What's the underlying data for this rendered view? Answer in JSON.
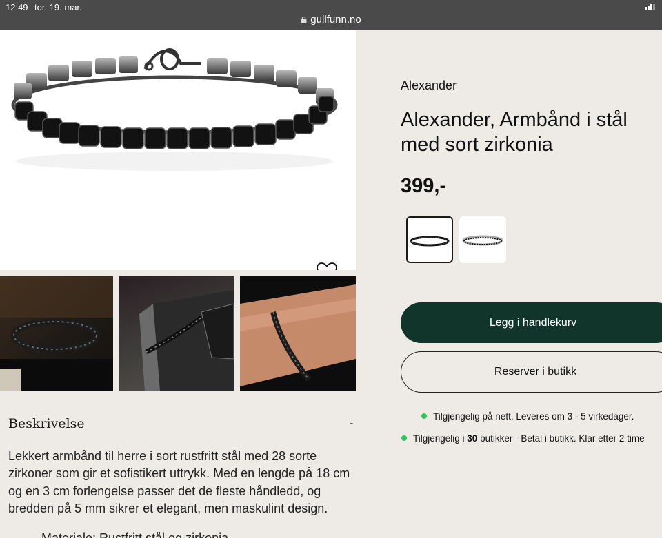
{
  "status_bar": {
    "time": "12:49",
    "date": "tor. 19. mar.",
    "url": "gullfunn.no"
  },
  "icons": {
    "favorite": "heart-outline-icon",
    "lock": "lock-icon",
    "signal": "signal-icon"
  },
  "product": {
    "brand": "Alexander",
    "title": "Alexander, Armbånd i stål med sort zirkonia",
    "price": "399,-"
  },
  "actions": {
    "add_to_cart": "Legg i handlekurv",
    "reserve": "Reserver i butikk"
  },
  "availability": {
    "online": "Tilgjengelig på nett. Leveres om 3 - 5 virkedager.",
    "stores_prefix": "Tilgjengelig i ",
    "stores_count": "30",
    "stores_suffix": " butikker - Betal i butikk. Klar etter 2 time"
  },
  "description": {
    "heading": "Beskrivelse",
    "toggle": "-",
    "text": "Lekkert armbånd til herre i sort rustfritt stål med 28 sorte zirkoner som gir et sofistikert uttrykk. Med en lengde på 18 cm og en 3 cm forlengelse passer det de fleste håndledd, og bredden på 5 mm sikrer et elegant, men maskulint design.",
    "next_line": "Materiale: Rustfritt stål og zirkonia"
  },
  "colors": {
    "accent_green": "#11352a",
    "stock_dot": "#2ec55a",
    "page_bg": "#eeebe6"
  }
}
